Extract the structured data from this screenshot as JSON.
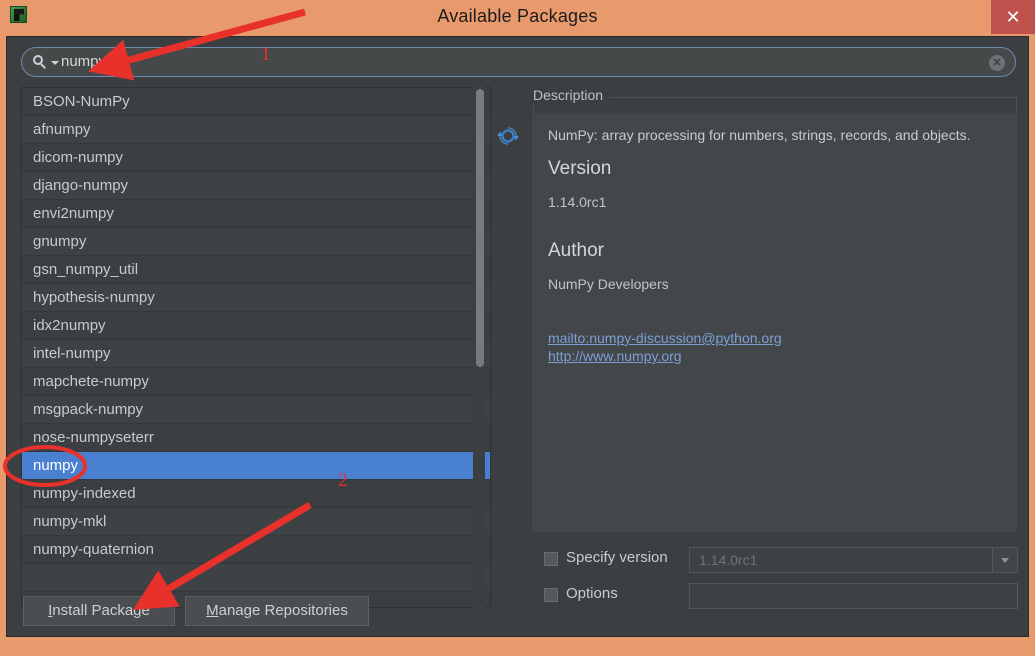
{
  "window": {
    "title": "Available Packages",
    "app_icon": "python-app-icon",
    "close_label": "✕"
  },
  "search": {
    "value": "numpy",
    "placeholder": "",
    "icon": "search-icon",
    "clear_label": "✕"
  },
  "toolbar": {
    "refresh_icon": "refresh-icon"
  },
  "packages": [
    {
      "name": "BSON-NumPy",
      "selected": false
    },
    {
      "name": "afnumpy",
      "selected": false
    },
    {
      "name": "dicom-numpy",
      "selected": false
    },
    {
      "name": "django-numpy",
      "selected": false
    },
    {
      "name": "envi2numpy",
      "selected": false
    },
    {
      "name": "gnumpy",
      "selected": false
    },
    {
      "name": "gsn_numpy_util",
      "selected": false
    },
    {
      "name": "hypothesis-numpy",
      "selected": false
    },
    {
      "name": "idx2numpy",
      "selected": false
    },
    {
      "name": "intel-numpy",
      "selected": false
    },
    {
      "name": "mapchete-numpy",
      "selected": false
    },
    {
      "name": "msgpack-numpy",
      "selected": false
    },
    {
      "name": "nose-numpyseterr",
      "selected": false
    },
    {
      "name": "numpy",
      "selected": true
    },
    {
      "name": "numpy-indexed",
      "selected": false
    },
    {
      "name": "numpy-mkl",
      "selected": false
    },
    {
      "name": "numpy-quaternion",
      "selected": false
    },
    {
      "name": "",
      "selected": false
    }
  ],
  "description": {
    "legend": "Description",
    "summary": "NumPy: array processing for numbers, strings, records, and objects.",
    "version_heading": "Version",
    "version_value": "1.14.0rc1",
    "author_heading": "Author",
    "author_value": "NumPy Developers",
    "mail_link": "mailto:numpy-discussion@python.org",
    "site_link": "http://www.numpy.org"
  },
  "options_panel": {
    "specify_version_label": "Specify version",
    "specify_version_checked": false,
    "version_combo_value": "1.14.0rc1",
    "options_label": "Options",
    "options_checked": false,
    "options_value": ""
  },
  "footer": {
    "install_mnemonic": "I",
    "install_rest": "nstall Package",
    "manage_mnemonic": "M",
    "manage_rest": "anage Repositories"
  },
  "annotations": {
    "one": "1",
    "two": "2",
    "color": "#e8312a"
  },
  "colors": {
    "frame": "#e89a6c",
    "dialog": "#3c3f41",
    "selection": "#4a80d0",
    "link": "#7c9fd6",
    "close": "#c0504d"
  }
}
